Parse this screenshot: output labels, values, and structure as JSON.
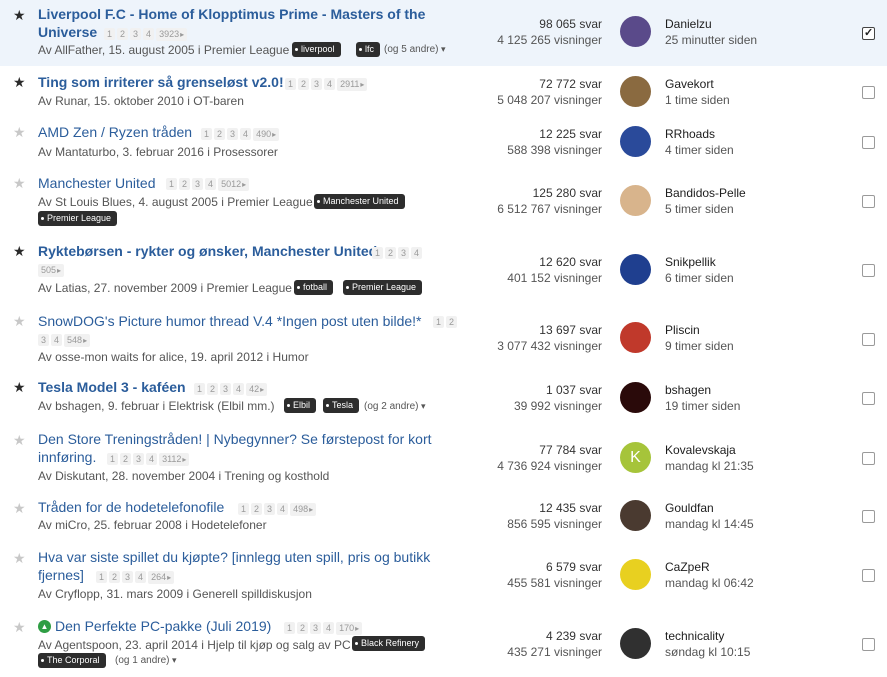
{
  "threads": [
    {
      "title": "Liverpool F.C - Home of Klopptimus Prime - Masters of the",
      "title2": "Universe",
      "pages": [
        "1",
        "2",
        "3",
        "4",
        "3923"
      ],
      "meta": "Av AllFather, 15. august 2005 i Premier League",
      "tags": [
        "liverpool",
        "lfc"
      ],
      "others": "(og 5 andre)",
      "replies": "98 065 svar",
      "views": "4 125 265 visninger",
      "user": "Danielzu",
      "time": "25 minutter siden",
      "starred": true,
      "bold": true,
      "checked": true,
      "avatar_color": "#5a4a8a"
    },
    {
      "title": "Ting som irriterer så grenseløst v2.0!",
      "pages": [
        "1",
        "2",
        "3",
        "4",
        "2911"
      ],
      "meta": "Av Runar, 15. oktober 2010 i OT-baren",
      "tags": [],
      "replies": "72 772 svar",
      "views": "5 048 207 visninger",
      "user": "Gavekort",
      "time": "1 time siden",
      "starred": true,
      "bold": true,
      "checked": false,
      "avatar_color": "#8a6a40"
    },
    {
      "title": "AMD Zen / Ryzen tråden",
      "pages": [
        "1",
        "2",
        "3",
        "4",
        "490"
      ],
      "meta": "Av Mantaturbo, 3. februar 2016 i Prosessorer",
      "tags": [],
      "replies": "12 225 svar",
      "views": "588 398 visninger",
      "user": "RRhoads",
      "time": "4 timer siden",
      "starred": false,
      "bold": false,
      "checked": false,
      "avatar_color": "#2a4a9a"
    },
    {
      "title": "Manchester United",
      "pages": [
        "1",
        "2",
        "3",
        "4",
        "5012"
      ],
      "meta": "Av St Louis Blues, 4. august 2005 i Premier League",
      "tags": [
        "Manchester United",
        "Premier League"
      ],
      "replies": "125 280 svar",
      "views": "6 512 767 visninger",
      "user": "Bandidos-Pelle",
      "time": "5 timer siden",
      "starred": false,
      "bold": false,
      "checked": false,
      "avatar_color": "#d8b48c"
    },
    {
      "title": "Ryktebørsen - rykter og ønsker, Manchester United",
      "pages": [
        "1",
        "2",
        "3",
        "4",
        "505"
      ],
      "meta": "Av Latias, 27. november 2009 i Premier League",
      "tags": [
        "fotball",
        "Premier League"
      ],
      "replies": "12 620 svar",
      "views": "401 152 visninger",
      "user": "Snikpellik",
      "time": "6 timer siden",
      "starred": true,
      "bold": true,
      "checked": false,
      "avatar_color": "#1f3f8f"
    },
    {
      "title": "SnowDOG's Picture humor thread V.4 *Ingen post uten bilde!*",
      "pages": [
        "1",
        "2",
        "3",
        "4",
        "548"
      ],
      "meta": "Av osse-mon waits for alice, 19. april 2012 i Humor",
      "tags": [],
      "replies": "13 697 svar",
      "views": "3 077 432 visninger",
      "user": "Pliscin",
      "time": "9 timer siden",
      "starred": false,
      "bold": false,
      "checked": false,
      "avatar_color": "#c0392b"
    },
    {
      "title": "Tesla Model 3 - kaféen",
      "pages": [
        "1",
        "2",
        "3",
        "4",
        "42"
      ],
      "meta": "Av bshagen, 9. februar i Elektrisk (Elbil mm.)",
      "tags": [
        "Elbil",
        "Tesla"
      ],
      "others": "(og 2 andre)",
      "replies": "1 037 svar",
      "views": "39 992 visninger",
      "user": "bshagen",
      "time": "19 timer siden",
      "starred": true,
      "bold": true,
      "checked": false,
      "avatar_color": "#2a0a0a"
    },
    {
      "title": "Den Store Treningstråden! | Nybegynner? Se førstepost for kort",
      "title2": "innføring.",
      "pages": [
        "1",
        "2",
        "3",
        "4",
        "3112"
      ],
      "meta": "Av Diskutant, 28. november 2004 i Trening og kosthold",
      "tags": [],
      "replies": "77 784 svar",
      "views": "4 736 924 visninger",
      "user": "Kovalevskaja",
      "time": "mandag kl 21:35",
      "starred": false,
      "bold": false,
      "checked": false,
      "avatar_color": "#a6c43a",
      "avatar_letter": "K"
    },
    {
      "title": "Tråden for de hodetelefonofile",
      "pages": [
        "1",
        "2",
        "3",
        "4",
        "498"
      ],
      "meta": "Av miCro, 25. februar 2008 i Hodetelefoner",
      "tags": [],
      "replies": "12 435 svar",
      "views": "856 595 visninger",
      "user": "Gouldfan",
      "time": "mandag kl 14:45",
      "starred": false,
      "bold": false,
      "checked": false,
      "avatar_color": "#4a3a30"
    },
    {
      "title": "Hva var siste spillet du kjøpte? [innlegg uten spill, pris og butikk",
      "title2": "fjernes]",
      "pages": [
        "1",
        "2",
        "3",
        "4",
        "264"
      ],
      "meta": "Av Cryflopp, 31. mars 2009 i Generell spilldiskusjon",
      "tags": [],
      "replies": "6 579 svar",
      "views": "455 581 visninger",
      "user": "CaZpeR",
      "time": "mandag kl 06:42",
      "starred": false,
      "bold": false,
      "checked": false,
      "avatar_color": "#e8d020"
    },
    {
      "title": "Den Perfekte PC-pakke (Juli 2019)",
      "pages": [
        "1",
        "2",
        "3",
        "4",
        "170"
      ],
      "meta": "Av Agentspoon, 23. april 2014 i Hjelp til kjøp og salg av PC",
      "tags": [
        "Black Refinery",
        "The Corporal"
      ],
      "others": "(og 1 andre)",
      "replies": "4 239 svar",
      "views": "435 271 visninger",
      "user": "technicality",
      "time": "søndag kl 10:15",
      "starred": false,
      "bold": false,
      "checked": false,
      "pinned": true,
      "avatar_color": "#303030"
    }
  ],
  "icons": {
    "star": "star-icon",
    "pin": "pin-icon",
    "checkbox": "checkbox"
  }
}
